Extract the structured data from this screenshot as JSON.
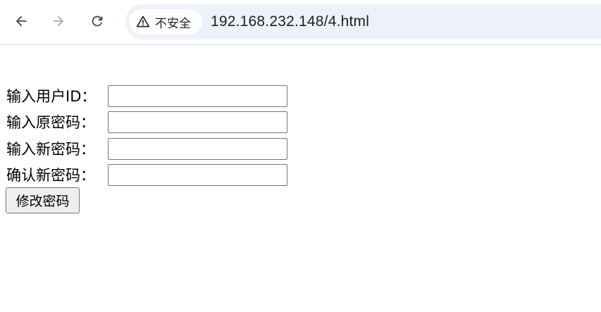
{
  "browser": {
    "security_chip_label": "不安全",
    "url": "192.168.232.148/4.html",
    "icons": {
      "back": "back-arrow-icon",
      "forward": "forward-arrow-icon",
      "reload": "reload-icon",
      "warning": "warning-triangle-icon"
    }
  },
  "form": {
    "user_id_label": "输入用户ID：",
    "old_password_label": "输入原密码：",
    "new_password_label": "输入新密码：",
    "confirm_password_label": "确认新密码：",
    "user_id_value": "",
    "old_password_value": "",
    "new_password_value": "",
    "confirm_password_value": "",
    "submit_label": "修改密码"
  }
}
